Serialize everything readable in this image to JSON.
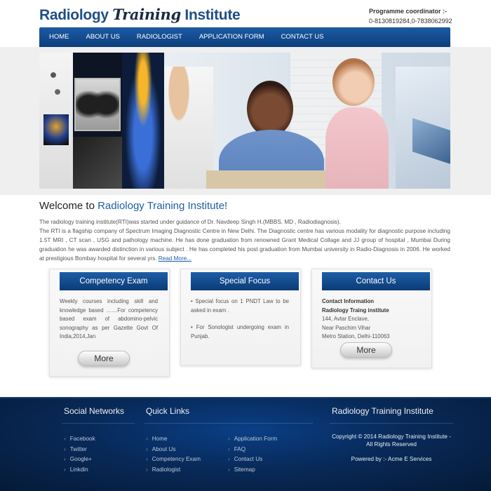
{
  "header": {
    "logo_part1": "Radiology ",
    "logo_part2": "Training",
    "logo_part3": " Institute",
    "coordinator_label": "Programme coordinator :-",
    "coordinator_phones": "0-8130819284,0-7838062992"
  },
  "nav": {
    "items": [
      "HOME",
      "ABOUT US",
      "RADIOLOGIST",
      "APPLICATION FORM",
      "CONTACT US"
    ]
  },
  "welcome": {
    "prefix": "Welcome to ",
    "name": "Radiology Training Institute!",
    "para1": "The radiology training institute(RTI)was started under guidance of Dr. Navdeep Singh H.(MBBS. MD , Radiodiagnosis).",
    "para2": "The RTI is a flagship company of Spectrum Imaging Diagnostic Centre in New Delhi. The Diagnostic centre has various modality for diagnostic purpose including 1.5T MRI , CT scan , USG and pathology machine. He has done graduation from renowned Grant Medical Collage and JJ group of hospital , Mumbai During graduation he was awarded distinction in various subject . He has completed his post graduation from Mumbai university in Radio-Diagnosis in 2006. He worked at prestigious Bombay hospital for several yrs.",
    "read_more": "Read More..."
  },
  "boxes": {
    "competency": {
      "title": "Competency Exam",
      "text": "Weekly courses including skill and knowledge based ……For competency based exam of abdomino-pelvic sonography as per Gazette Govt Of India,2014,Jan",
      "button": "More"
    },
    "special": {
      "title": "Special Focus",
      "item1": "• Special focus on 1 PNDT Law to be asked in exam .",
      "item2": "• For Sonologist undergoing exam in Punjab."
    },
    "contact": {
      "title": "Contact Us",
      "line1": "Contact Information",
      "line2": "Radiology Traing institute",
      "line3": "144, Avtar Enclave,",
      "line4": "Near Paschim Vihar",
      "line5": "Metro Station, Delhi-110063",
      "button": "More"
    }
  },
  "footer": {
    "social_heading": "Social Networks",
    "social": [
      "Facebook",
      "Twitter",
      "Google+",
      "Linkdin"
    ],
    "quick_heading": "Quick Links",
    "quick_col1": [
      "Home",
      "About Us",
      "Competency Exam",
      "Radiologist"
    ],
    "quick_col2": [
      "Application Form",
      "FAQ",
      "Contact Us",
      "Sitemap"
    ],
    "institute_heading": "Radiology Training Institute",
    "copyright": "Copyright © 2014 Radiology Training Institute - All Rights Reserved",
    "powered": "Powered by :- Acme E Services",
    "arrow_glyph": "›"
  }
}
